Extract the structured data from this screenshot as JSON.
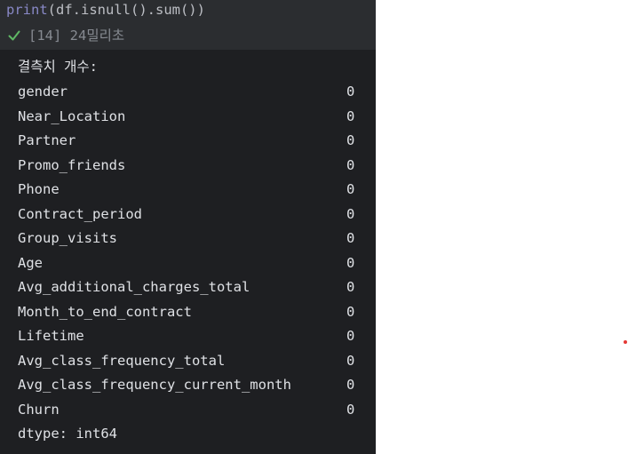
{
  "code": {
    "fn": "print",
    "args": "(df.isnull().sum())"
  },
  "status": {
    "icon": "check-icon",
    "text": "[14] 24밀리초",
    "check_color": "#5fb865"
  },
  "output": {
    "header": "결측치 개수:",
    "rows": [
      {
        "name": "gender",
        "value": "0"
      },
      {
        "name": "Near_Location",
        "value": "0"
      },
      {
        "name": "Partner",
        "value": "0"
      },
      {
        "name": "Promo_friends",
        "value": "0"
      },
      {
        "name": "Phone",
        "value": "0"
      },
      {
        "name": "Contract_period",
        "value": "0"
      },
      {
        "name": "Group_visits",
        "value": "0"
      },
      {
        "name": "Age",
        "value": "0"
      },
      {
        "name": "Avg_additional_charges_total",
        "value": "0"
      },
      {
        "name": "Month_to_end_contract",
        "value": "0"
      },
      {
        "name": "Lifetime",
        "value": "0"
      },
      {
        "name": "Avg_class_frequency_total",
        "value": "0"
      },
      {
        "name": "Avg_class_frequency_current_month",
        "value": "0"
      },
      {
        "name": "Churn",
        "value": "0"
      }
    ],
    "dtype": "dtype: int64"
  },
  "colors": {
    "panel_bg": "#1e1f22",
    "cell_bg": "#2b2d30",
    "text": "#dfe1e5",
    "dot": "#e53935"
  }
}
